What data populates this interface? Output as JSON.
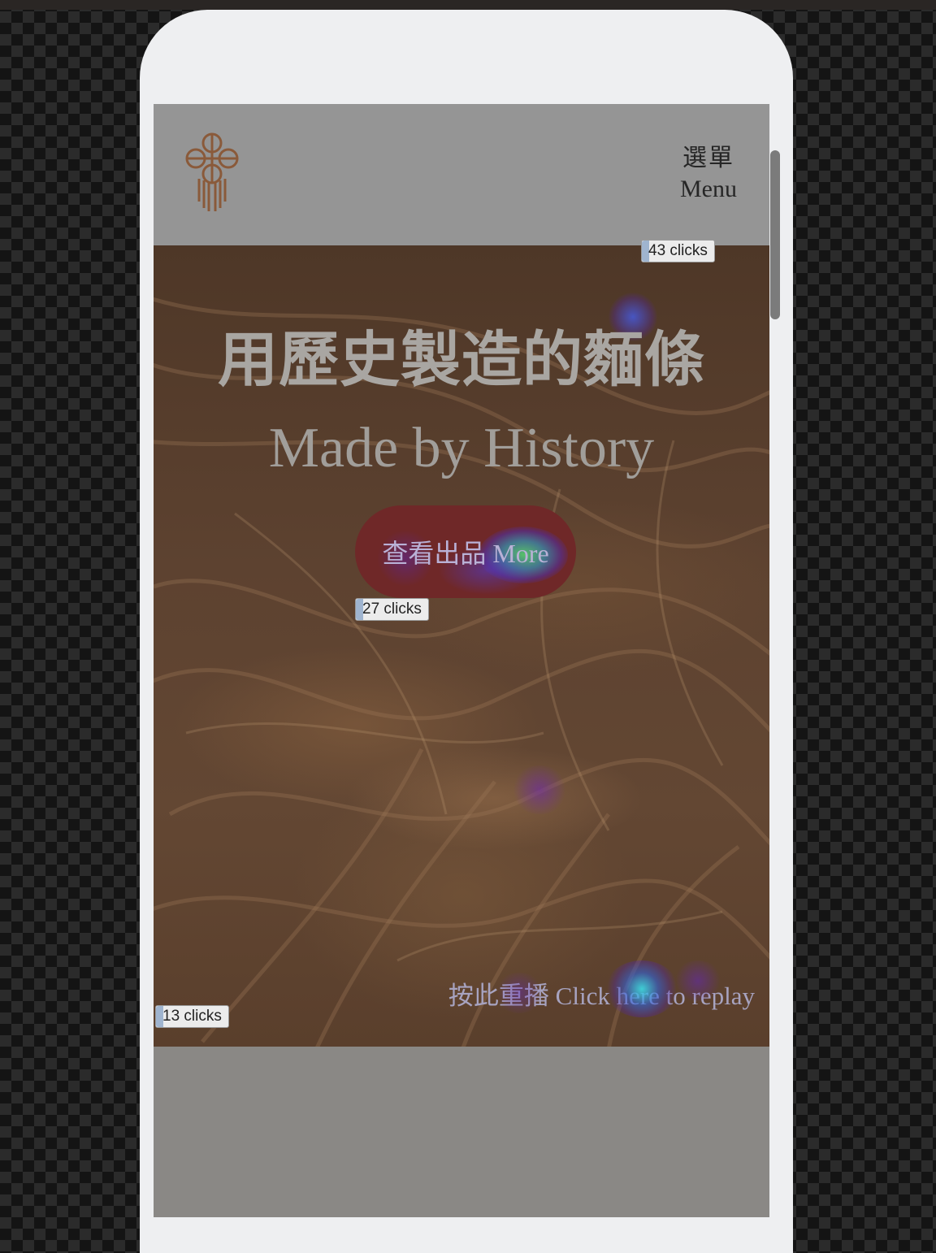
{
  "header": {
    "logo_icon": "knot-logo-icon",
    "menu_label_zh": "選單",
    "menu_label_en": "Menu"
  },
  "hero": {
    "title_zh": "用歷史製造的麵條",
    "title_en": "Made by History",
    "more_button": "查看出品 More",
    "replay_link": "按此重播 Click here to replay"
  },
  "heatmap": {
    "badges": [
      {
        "label": "43 clicks"
      },
      {
        "label": "27 clicks"
      },
      {
        "label": "13 clicks"
      }
    ]
  },
  "colors": {
    "logo": "#8a5a3a",
    "more_button_bg": "#6f2828",
    "header_bg": "#959595"
  }
}
